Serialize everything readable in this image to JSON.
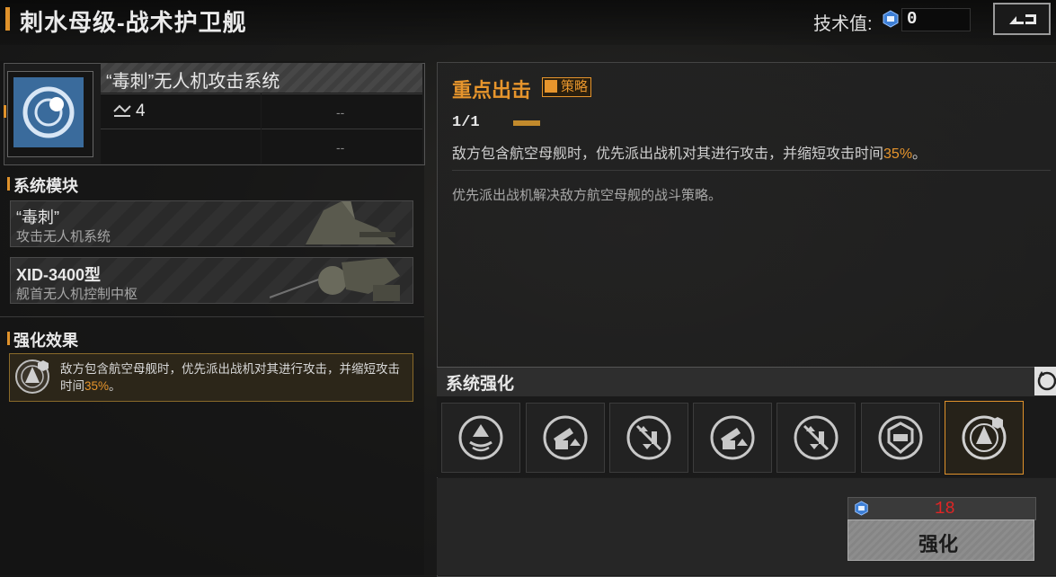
{
  "header": {
    "title": "刺水母级-战术护卫舰",
    "tech_label": "技术值:",
    "tech_value": "0"
  },
  "weapon": {
    "name": "“毒刺”无人机攻击系统",
    "level": "4",
    "dash_1": "--",
    "dash_2": "--"
  },
  "modules": {
    "heading": "系统模块",
    "items": [
      {
        "title": "“毒刺”",
        "subtitle": "攻击无人机系统"
      },
      {
        "title": "XID-3400型",
        "subtitle": "舰首无人机控制中枢"
      }
    ]
  },
  "effect": {
    "heading": "强化效果",
    "text_pre": "敌方包含航空母舰时，优先派出战机对其进行攻击，并缩短攻击时间",
    "text_pct": "35%",
    "text_post": "。"
  },
  "strategy": {
    "title": "重点出击",
    "tag": "策略",
    "progress": "1/1",
    "desc_pre": "敌方包含航空母舰时，优先派出战机对其进行攻击，并缩短攻击时间",
    "desc_pct": "35%",
    "desc_post": "。",
    "flavor": "优先派出战机解决敌方航空母舰的战斗策略。"
  },
  "enhance": {
    "heading": "系统强化",
    "skills": [
      {
        "icon": "launch-wave-icon"
      },
      {
        "icon": "turret-up-icon"
      },
      {
        "icon": "cancel-swap-icon"
      },
      {
        "icon": "turret-up-icon"
      },
      {
        "icon": "cancel-swap-icon"
      },
      {
        "icon": "shield-badge-icon"
      },
      {
        "icon": "target-drone-icon",
        "selected": true
      }
    ],
    "cost": "18",
    "button_label": "强化"
  },
  "colors": {
    "accent": "#e7952c",
    "cost": "#e02525"
  }
}
